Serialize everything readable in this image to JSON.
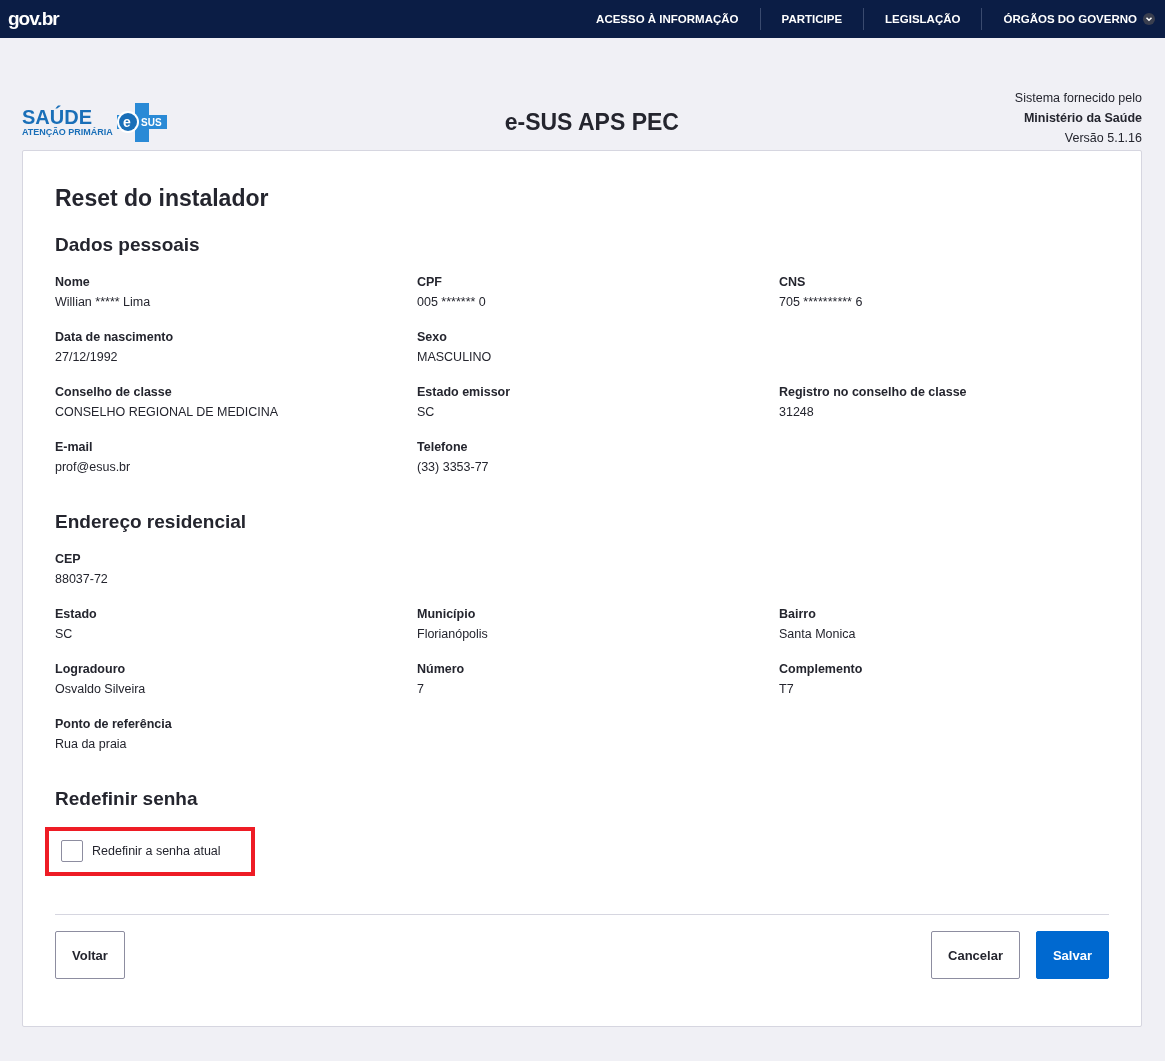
{
  "top_bar": {
    "logo": "gov.br",
    "links": [
      {
        "label": "ACESSO À INFORMAÇÃO"
      },
      {
        "label": "PARTICIPE"
      },
      {
        "label": "LEGISLAÇÃO"
      },
      {
        "label": "ÓRGÃOS DO GOVERNO",
        "dropdown": true
      }
    ]
  },
  "header": {
    "logo": {
      "word": "SAÚDE",
      "tagline": "ATENÇÃO PRIMÁRIA",
      "badge_letter": "e",
      "badge_text": "SUS"
    },
    "title": "e-SUS APS PEC",
    "provider_line": "Sistema fornecido pelo",
    "provider": "Ministério da Saúde",
    "version": "Versão 5.1.16"
  },
  "page_title": "Reset do instalador",
  "sections": [
    {
      "title": "Dados pessoais",
      "rows": [
        [
          {
            "label": "Nome",
            "value": "Willian ***** Lima"
          },
          {
            "label": "CPF",
            "value": "005 *******  0"
          },
          {
            "label": "CNS",
            "value": "705 ********** 6"
          }
        ],
        [
          {
            "label": "Data de nascimento",
            "value": "27/12/1992"
          },
          {
            "label": "Sexo",
            "value": "MASCULINO"
          }
        ],
        [
          {
            "label": "Conselho de classe",
            "value": "CONSELHO REGIONAL DE MEDICINA"
          },
          {
            "label": "Estado emissor",
            "value": "SC"
          },
          {
            "label": "Registro no conselho de classe",
            "value": "31248"
          }
        ],
        [
          {
            "label": "E-mail",
            "value": "prof@esus.br"
          },
          {
            "label": "Telefone",
            "value": "(33) 3353-77"
          }
        ]
      ]
    },
    {
      "title": "Endereço residencial",
      "rows": [
        [
          {
            "label": "CEP",
            "value": "88037-72"
          }
        ],
        [
          {
            "label": "Estado",
            "value": "SC"
          },
          {
            "label": "Município",
            "value": "Florianópolis"
          },
          {
            "label": "Bairro",
            "value": "Santa Monica"
          }
        ],
        [
          {
            "label": "Logradouro",
            "value": "Osvaldo Silveira"
          },
          {
            "label": "Número",
            "value": "7"
          },
          {
            "label": "Complemento",
            "value": "T7"
          }
        ],
        [
          {
            "label": "Ponto de referência",
            "value": "Rua da praia"
          }
        ]
      ]
    }
  ],
  "password": {
    "title": "Redefinir senha",
    "checkbox": {
      "label": "Redefinir a senha atual",
      "checked": false,
      "highlighted": true
    }
  },
  "buttons": [
    {
      "label": "Voltar",
      "kind": "secondary"
    },
    {
      "label": "Cancelar",
      "kind": "secondary"
    },
    {
      "label": "Salvar",
      "kind": "primary"
    }
  ]
}
